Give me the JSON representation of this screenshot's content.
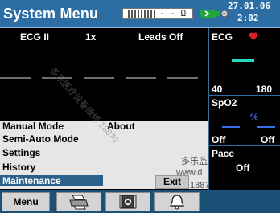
{
  "header": {
    "title": "System Menu",
    "battery_text": "- - Ω",
    "date": "27.01.06",
    "time": "2:02"
  },
  "waveform": {
    "lead": "ECG II",
    "gain": "1x",
    "status": "Leads Off"
  },
  "params": {
    "ecg": {
      "label": "ECG",
      "low": "40",
      "high": "180"
    },
    "spo2": {
      "label": "SpO2",
      "unit": "%",
      "low": "Off",
      "high": "Off"
    },
    "pace": {
      "label": "Pace",
      "value": "Off"
    }
  },
  "menu": {
    "items": [
      "Manual Mode",
      "Semi-Auto Mode",
      "Settings",
      "History",
      "Maintenance"
    ],
    "about": "About",
    "exit": "Exit"
  },
  "toolbar": {
    "menu_label": "Menu"
  },
  "watermark": {
    "diagonal": "多乐医疗设备维修 18870",
    "line1": "多乐监",
    "line2": "www.d",
    "line3": "1887"
  },
  "colors": {
    "header_bg": "#2c6ea3",
    "selected_bg": "#2c5f8a",
    "heart": "#e02020",
    "spo2_blue": "#3a6ee8",
    "ecg_trace": "#29d9c0"
  }
}
